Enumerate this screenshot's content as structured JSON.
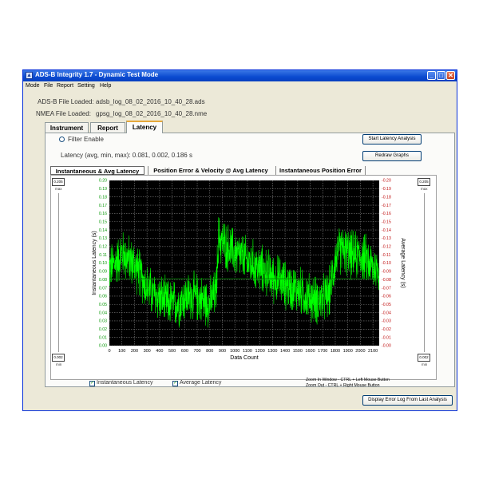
{
  "window": {
    "title": "ADS-B Integrity 1.7 - Dynamic Test Mode",
    "minimize": "_",
    "maximize": "□",
    "close": "✕"
  },
  "menu": [
    "Mode",
    "File",
    "Report",
    "Setting",
    "Help"
  ],
  "files": {
    "adsb_label": "ADS-B File Loaded:",
    "adsb_value": "adsb_log_08_02_2016_10_40_28.ads",
    "nmea_label": "NMEA File Loaded:",
    "nmea_value": "gpsg_log_08_02_2016_10_40_28.nme"
  },
  "tabs": [
    "Instrument",
    "Report",
    "Latency"
  ],
  "active_tab": "Latency",
  "filter_enable": "Filter Enable",
  "latency_summary": "Latency (avg, min, max):  0.081, 0.002, 0.186 s",
  "buttons": {
    "start": "Start Latency Analysis",
    "redraw": "Redraw Graphs",
    "display_log": "Display Error Log From Last Analysis"
  },
  "subtabs": [
    "Instantaneous & Avg Latency",
    "Position Error & Velocity @ Avg Latency",
    "Instantaneous Position Error"
  ],
  "side": {
    "left_top": "0.205",
    "left_top_label": "max",
    "left_bottom": "0.002",
    "left_bottom_label": "min",
    "right_top": "0.205",
    "right_top_label": "max",
    "right_bottom": "0.002",
    "right_bottom_label": "min"
  },
  "legend": {
    "inst": "Instantaneous Latency",
    "avg": "Average Latency"
  },
  "zoom": {
    "in": "Zoom In Window - CTRL + Left Mouse Button",
    "out": "Zoom Out - CTRL + Right Mouse Button"
  },
  "chart_data": {
    "type": "line",
    "xlabel": "Data Count",
    "ylabel": "Instantaneous Latency (s)",
    "y2label": "Average Latency (s)",
    "xlim": [
      0,
      2150
    ],
    "ylim": [
      0,
      0.2
    ],
    "y2lim": [
      0,
      0.2
    ],
    "xticks": [
      0,
      100,
      200,
      300,
      400,
      500,
      600,
      700,
      800,
      900,
      1000,
      1100,
      1200,
      1300,
      1400,
      1500,
      1600,
      1700,
      1800,
      1900,
      2000,
      2100
    ],
    "yticks": [
      "0.00",
      "0.01",
      "0.02",
      "0.03",
      "0.04",
      "0.05",
      "0.06",
      "0.07",
      "0.08",
      "0.09",
      "0.10",
      "0.11",
      "0.12",
      "0.13",
      "0.14",
      "0.15",
      "0.16",
      "0.17",
      "0.18",
      "0.19",
      "0.20"
    ],
    "y2ticks": [
      "-0.00",
      "-0.01",
      "-0.02",
      "-0.03",
      "-0.04",
      "-0.05",
      "-0.06",
      "-0.07",
      "-0.08",
      "-0.09",
      "-0.10",
      "-0.11",
      "-0.12",
      "-0.13",
      "-0.14",
      "-0.15",
      "-0.16",
      "-0.17",
      "-0.18",
      "-0.19",
      "-0.20"
    ],
    "grid": true,
    "background": "#000000",
    "series": [
      {
        "name": "Instantaneous Latency",
        "color": "#00ff00",
        "envelope_x": [
          0,
          50,
          100,
          150,
          200,
          250,
          300,
          350,
          400,
          450,
          500,
          550,
          600,
          650,
          700,
          750,
          800,
          850,
          870,
          900,
          950,
          1000,
          1050,
          1100,
          1150,
          1200,
          1250,
          1300,
          1350,
          1400,
          1450,
          1500,
          1550,
          1600,
          1650,
          1700,
          1750,
          1800,
          1850,
          1900,
          1950,
          2000,
          2050,
          2100,
          2150
        ],
        "center_y": [
          0.093,
          0.1,
          0.112,
          0.105,
          0.098,
          0.085,
          0.07,
          0.062,
          0.058,
          0.052,
          0.05,
          0.052,
          0.058,
          0.06,
          0.058,
          0.055,
          0.052,
          0.065,
          0.13,
          0.126,
          0.118,
          0.112,
          0.108,
          0.102,
          0.098,
          0.092,
          0.09,
          0.082,
          0.08,
          0.074,
          0.07,
          0.068,
          0.062,
          0.058,
          0.055,
          0.056,
          0.062,
          0.105,
          0.118,
          0.112,
          0.108,
          0.11,
          0.104,
          0.095,
          0.092
        ],
        "spread": 0.035
      },
      {
        "name": "Average Latency",
        "color": "#007700",
        "y": 0.081
      }
    ]
  }
}
